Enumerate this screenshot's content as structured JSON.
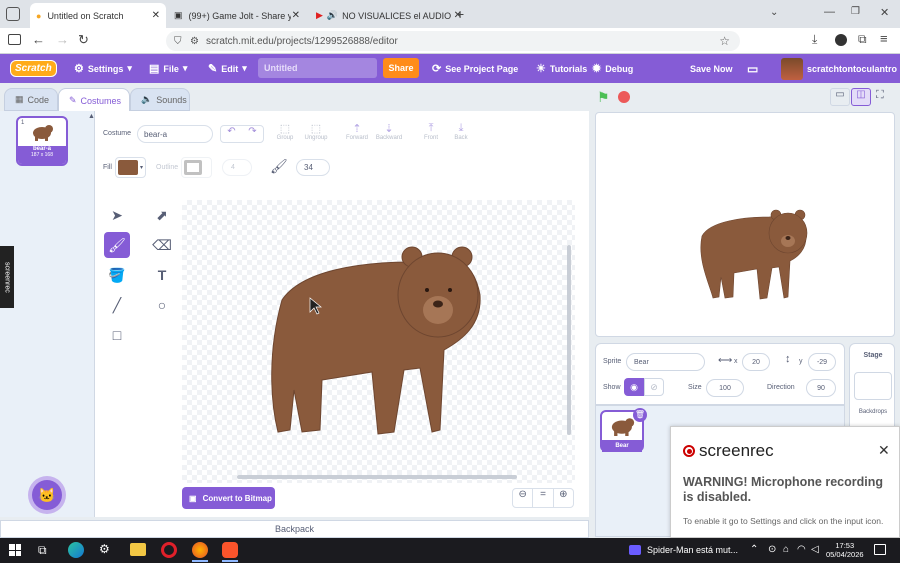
{
  "browser": {
    "tabs": [
      {
        "title": "Untitled on Scratch",
        "active": true
      },
      {
        "title": "(99+) Game Jolt - Share your cr",
        "active": false
      },
      {
        "title": "NO VISUALICES el AUDIO",
        "active": false
      }
    ],
    "url": "scratch.mit.edu/projects/1299526888/editor"
  },
  "menubar": {
    "logo": "Scratch",
    "settings": "Settings",
    "file": "File",
    "edit": "Edit",
    "project_title": "Untitled",
    "share": "Share",
    "see_project": "See Project Page",
    "tutorials": "Tutorials",
    "debug": "Debug",
    "save_now": "Save Now",
    "username": "scratchtontoculantro"
  },
  "editor_tabs": {
    "code": "Code",
    "costumes": "Costumes",
    "sounds": "Sounds"
  },
  "costume_list": [
    {
      "index": "1",
      "name": "bear-a",
      "size": "187 x 168"
    }
  ],
  "paint": {
    "costume_label": "Costume",
    "costume_name": "bear-a",
    "group": "Group",
    "ungroup": "Ungroup",
    "forward": "Forward",
    "backward": "Backward",
    "front": "Front",
    "back": "Back",
    "fill_label": "Fill",
    "fill_color": "#8a5a3c",
    "outline_label": "Outline",
    "outline_width": "4",
    "brush_size": "34",
    "convert_button": "Convert to Bitmap",
    "zoom_reset": "="
  },
  "backpack": "Backpack",
  "sprite_info": {
    "sprite_label": "Sprite",
    "sprite_name": "Bear",
    "x_label": "x",
    "x_value": "20",
    "y_label": "y",
    "y_value": "-29",
    "show_label": "Show",
    "size_label": "Size",
    "size_value": "100",
    "direction_label": "Direction",
    "direction_value": "90"
  },
  "sprites": [
    {
      "name": "Bear"
    }
  ],
  "stage_panel": {
    "title": "Stage",
    "backdrops": "Backdrops"
  },
  "screenrec": {
    "side_tag": "screenrec",
    "brand": "screenrec",
    "warning": "WARNING! Microphone recording is disabled.",
    "hint": "To enable it go to Settings and click on the input icon."
  },
  "taskbar": {
    "media": "Spider-Man está mut...",
    "time": "17:53",
    "date": "05/04/2026"
  },
  "colors": {
    "scratch_purple": "#855cd6",
    "share_orange": "#ff8c1a",
    "bear_brown": "#8a5a3c"
  }
}
